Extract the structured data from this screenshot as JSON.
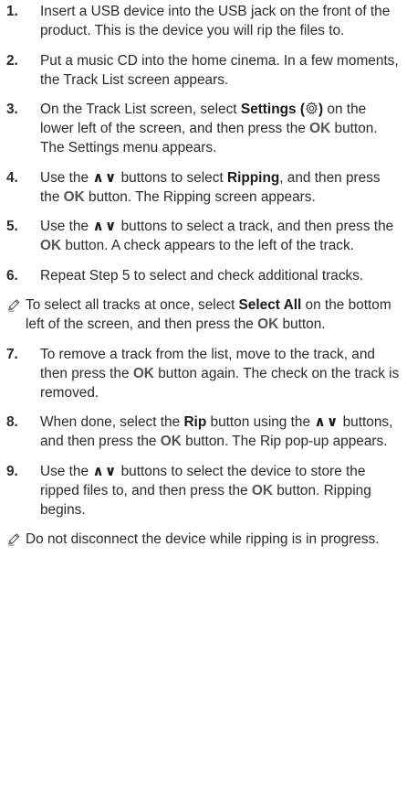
{
  "steps": [
    {
      "number": "1.",
      "parts": [
        {
          "t": "Insert a USB device into the USB jack on the front of the product. This is the device you will rip the files to."
        }
      ]
    },
    {
      "number": "2.",
      "parts": [
        {
          "t": "Put a music CD into the home cinema. In a few moments, the Track List screen appears."
        }
      ]
    },
    {
      "number": "3.",
      "parts": [
        {
          "t": "On the Track List screen, select "
        },
        {
          "b": "Settings"
        },
        {
          "t": " "
        },
        {
          "b": "("
        },
        {
          "icon": "gear-icon"
        },
        {
          "b": ")"
        },
        {
          "t": " on the lower left of the screen, and then press the "
        },
        {
          "ok": "OK"
        },
        {
          "t": " button. The Settings menu appears."
        }
      ]
    },
    {
      "number": "4.",
      "parts": [
        {
          "t": "Use the "
        },
        {
          "arrows": "∧∨"
        },
        {
          "t": " buttons to select "
        },
        {
          "b": "Ripping"
        },
        {
          "t": ", and then press the "
        },
        {
          "ok": "OK"
        },
        {
          "t": " button. The Ripping screen appears."
        }
      ]
    },
    {
      "number": "5.",
      "parts": [
        {
          "t": "Use the "
        },
        {
          "arrows": "∧∨"
        },
        {
          "t": " buttons to select a track, and then press the "
        },
        {
          "ok": "OK"
        },
        {
          "t": " button. A check appears to the left of the track."
        }
      ]
    },
    {
      "number": "6.",
      "parts": [
        {
          "t": "Repeat Step 5 to select and check additional tracks."
        }
      ]
    },
    {
      "note": true,
      "parts": [
        {
          "t": "To select all tracks at once, select "
        },
        {
          "b": "Select All"
        },
        {
          "t": " on the bottom left of the screen, and then press the "
        },
        {
          "ok": "OK"
        },
        {
          "t": " button."
        }
      ]
    },
    {
      "number": "7.",
      "parts": [
        {
          "t": "To remove a track from the list, move to the track, and then press the "
        },
        {
          "ok": "OK"
        },
        {
          "t": " button again. The check on the track is removed."
        }
      ]
    },
    {
      "number": "8.",
      "parts": [
        {
          "t": "When done, select the "
        },
        {
          "b": "Rip"
        },
        {
          "t": " button using the "
        },
        {
          "arrows": "∧∨"
        },
        {
          "t": " buttons, and then press the "
        },
        {
          "ok": "OK"
        },
        {
          "t": " button. The Rip pop-up appears."
        }
      ]
    },
    {
      "number": "9.",
      "parts": [
        {
          "t": "Use the "
        },
        {
          "arrows": "∧∨"
        },
        {
          "t": " buttons to select the device to store the ripped files to, and then press the "
        },
        {
          "ok": "OK"
        },
        {
          "t": " button. Ripping begins."
        }
      ]
    },
    {
      "note": true,
      "parts": [
        {
          "t": "Do not disconnect the device while ripping is in progress."
        }
      ]
    }
  ],
  "icons": {
    "note": "pencil-note-icon",
    "settings": "gear-icon"
  }
}
